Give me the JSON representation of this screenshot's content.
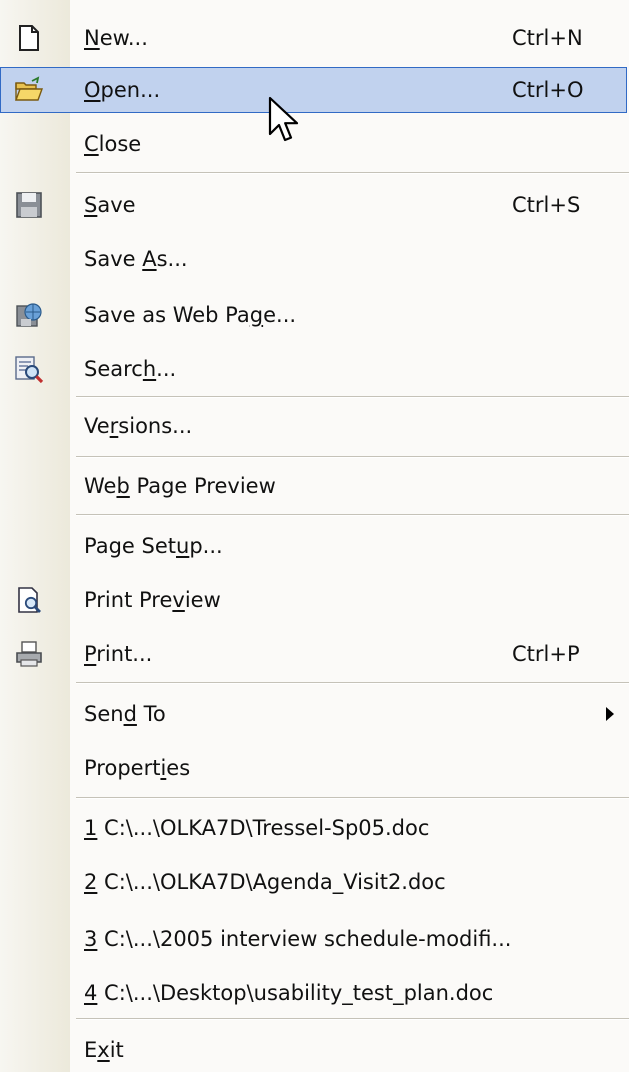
{
  "menu": {
    "items": [
      {
        "key": "new",
        "pre": "",
        "acc": "N",
        "post": "ew...",
        "shortcut": "Ctrl+N",
        "icon": "new-document-icon"
      },
      {
        "key": "open",
        "pre": "",
        "acc": "O",
        "post": "pen...",
        "shortcut": "Ctrl+O",
        "icon": "open-folder-icon",
        "highlighted": true
      },
      {
        "key": "close",
        "pre": "",
        "acc": "C",
        "post": "lose"
      },
      {
        "key": "save",
        "pre": "",
        "acc": "S",
        "post": "ave",
        "shortcut": "Ctrl+S",
        "icon": "save-disk-icon"
      },
      {
        "key": "save-as",
        "pre": "Save ",
        "acc": "A",
        "post": "s..."
      },
      {
        "key": "save-web",
        "pre": "Save as Web Pa",
        "acc": "g",
        "post": "e...",
        "icon": "save-web-page-icon"
      },
      {
        "key": "search",
        "pre": "Searc",
        "acc": "h",
        "post": "...",
        "icon": "search-icon"
      },
      {
        "key": "versions",
        "pre": "Ve",
        "acc": "r",
        "post": "sions..."
      },
      {
        "key": "web-preview",
        "pre": "We",
        "acc": "b",
        "post": " Page Preview"
      },
      {
        "key": "page-setup",
        "pre": "Page Set",
        "acc": "u",
        "post": "p..."
      },
      {
        "key": "print-preview",
        "pre": "Print Pre",
        "acc": "v",
        "post": "iew",
        "icon": "print-preview-icon"
      },
      {
        "key": "print",
        "pre": "",
        "acc": "P",
        "post": "rint...",
        "shortcut": "Ctrl+P",
        "icon": "printer-icon"
      },
      {
        "key": "send-to",
        "pre": "Sen",
        "acc": "d",
        "post": " To",
        "submenu": true
      },
      {
        "key": "properties",
        "pre": "Propert",
        "acc": "i",
        "post": "es"
      },
      {
        "key": "recent-1",
        "pre": "",
        "acc": "1",
        "post": " C:\\...\\OLKA7D\\Tressel-Sp05.doc"
      },
      {
        "key": "recent-2",
        "pre": "",
        "acc": "2",
        "post": " C:\\...\\OLKA7D\\Agenda_Visit2.doc"
      },
      {
        "key": "recent-3",
        "pre": "",
        "acc": "3",
        "post": " C:\\...\\2005 interview schedule-modifi..."
      },
      {
        "key": "recent-4",
        "pre": "",
        "acc": "4",
        "post": " C:\\...\\Desktop\\usability_test_plan.doc"
      },
      {
        "key": "exit",
        "pre": "E",
        "acc": "x",
        "post": "it"
      }
    ]
  },
  "colors": {
    "highlight": "#c1d2ee",
    "highlight_border": "#316ac5",
    "gutter": "#ece9db",
    "menu_bg": "#fbfaf8",
    "text": "#111111"
  }
}
